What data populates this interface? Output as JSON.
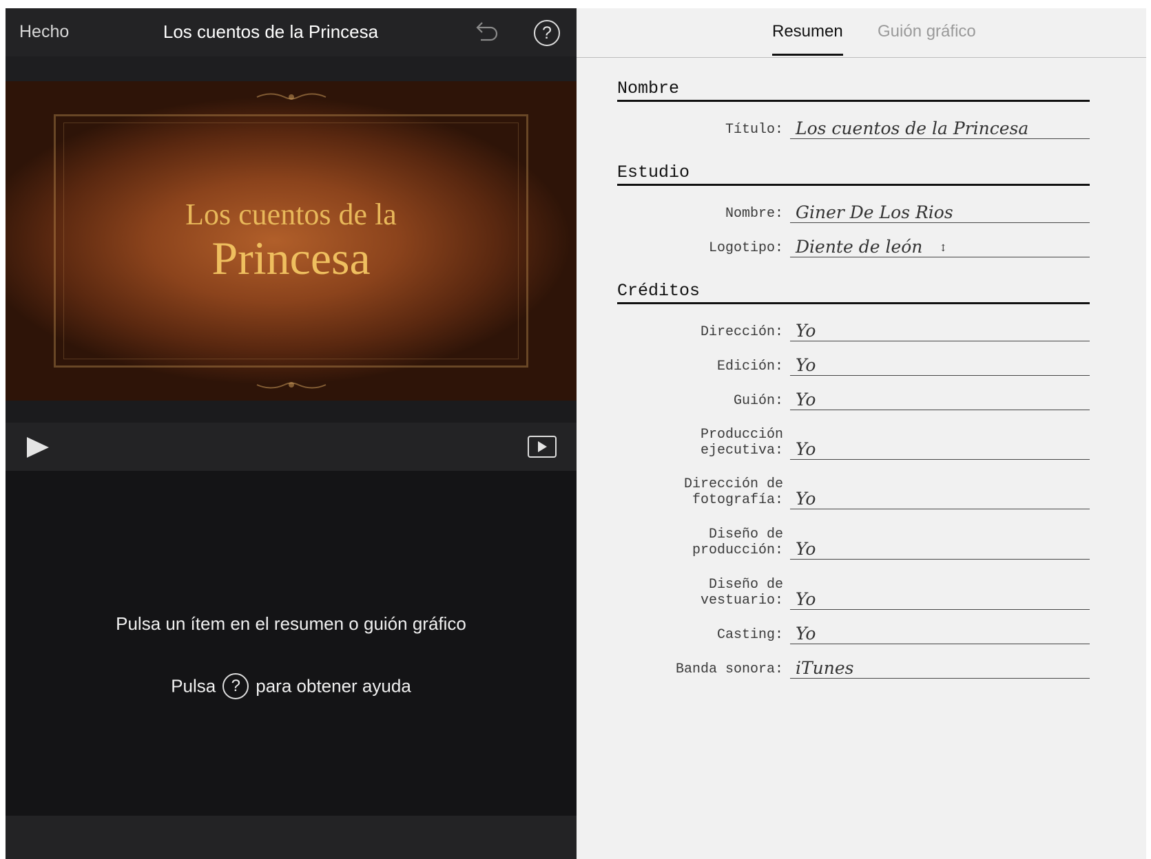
{
  "left": {
    "done_label": "Hecho",
    "project_title": "Los cuentos de la Princesa",
    "help_icon_glyph": "?",
    "preview": {
      "title_line1": "Los cuentos de la",
      "title_line2": "Princesa"
    },
    "hint_line1": "Pulsa un ítem en el resumen o guión gráfico",
    "hint_line2_before": "Pulsa",
    "hint_line2_after": "para obtener ayuda"
  },
  "tabs": [
    {
      "label": "Resumen",
      "active": true
    },
    {
      "label": "Guión gráfico",
      "active": false
    }
  ],
  "sections": {
    "nombre": "Nombre",
    "estudio": "Estudio",
    "creditos": "Créditos"
  },
  "fields": {
    "titulo": {
      "label": "Título:",
      "value": "Los cuentos de la Princesa"
    },
    "estudio_nombre": {
      "label": "Nombre:",
      "value": "Giner De Los Rios"
    },
    "logotipo": {
      "label": "Logotipo:",
      "value": "Diente de león"
    },
    "direccion": {
      "label": "Dirección:",
      "value": "Yo"
    },
    "edicion": {
      "label": "Edición:",
      "value": "Yo"
    },
    "guion": {
      "label": "Guión:",
      "value": "Yo"
    },
    "produccion_ejecutiva": {
      "label_line1": "Producción",
      "label_line2": "ejecutiva:",
      "value": "Yo"
    },
    "direccion_fotografia": {
      "label_line1": "Dirección de",
      "label_line2": "fotografía:",
      "value": "Yo"
    },
    "diseno_produccion": {
      "label_line1": "Diseño de",
      "label_line2": "producción:",
      "value": "Yo"
    },
    "diseno_vestuario": {
      "label_line1": "Diseño de",
      "label_line2": "vestuario:",
      "value": "Yo"
    },
    "casting": {
      "label": "Casting:",
      "value": "Yo"
    },
    "banda_sonora": {
      "label": "Banda sonora:",
      "value": "iTunes"
    }
  },
  "colors": {
    "dark_bg": "#141416",
    "bar_bg": "#232325",
    "right_bg": "#f1f1f1",
    "title_gold": "#e8b85a"
  }
}
